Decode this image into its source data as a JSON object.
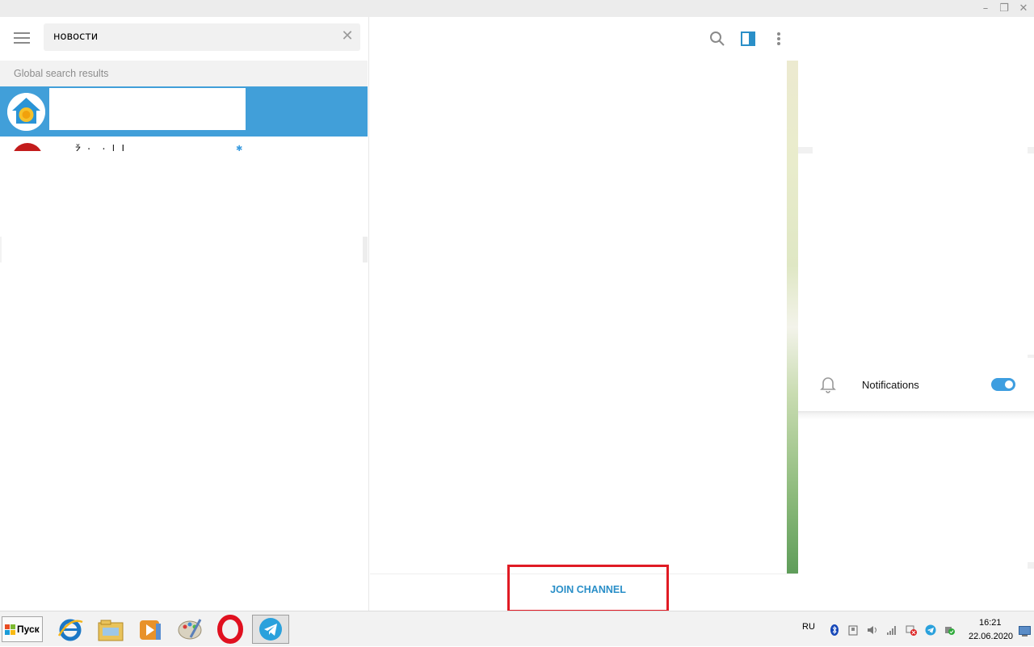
{
  "window": {
    "controls": {
      "minimize": "–",
      "restore": "❐",
      "close": "✕"
    }
  },
  "sidebar": {
    "search": {
      "value": "новости"
    },
    "section_header": "Global search results",
    "results": [
      {
        "selected": true
      },
      {
        "name_partial": "…ž ·. · l L"
      }
    ]
  },
  "chat": {
    "join_label": "JOIN CHANNEL"
  },
  "info": {
    "notifications_label": "Notifications",
    "notifications_enabled": true
  },
  "taskbar": {
    "start_label": "Пуск",
    "apps": [
      "internet-explorer",
      "file-explorer",
      "media-player",
      "paint",
      "opera",
      "telegram"
    ],
    "active_app": "telegram",
    "language": "RU",
    "time": "16:21",
    "date": "22.06.2020"
  },
  "colors": {
    "accent": "#419fd9",
    "highlight_box": "#e01b24",
    "join_text": "#2a8fc8"
  }
}
